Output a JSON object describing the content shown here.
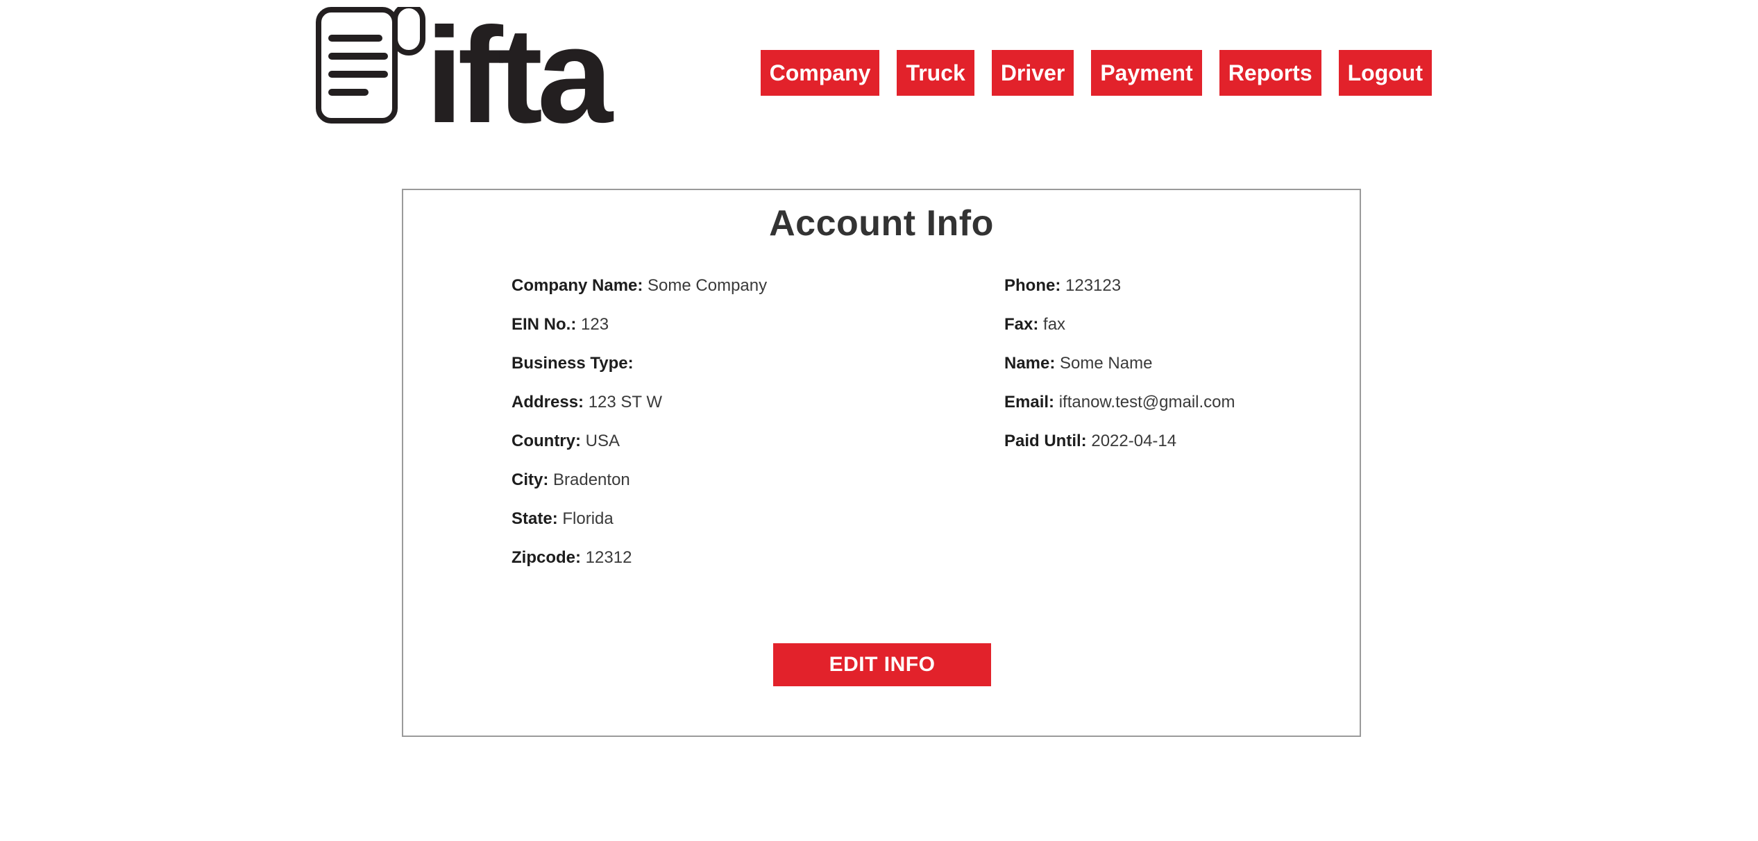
{
  "logo": {
    "text": "ifta",
    "icon": "document-icon"
  },
  "nav": [
    {
      "label": "Company"
    },
    {
      "label": "Truck"
    },
    {
      "label": "Driver"
    },
    {
      "label": "Payment"
    },
    {
      "label": "Reports"
    },
    {
      "label": "Logout"
    }
  ],
  "account": {
    "title": "Account Info",
    "left": [
      {
        "label": "Company Name:",
        "value": "Some Company"
      },
      {
        "label": "EIN No.:",
        "value": "123"
      },
      {
        "label": "Business Type:",
        "value": ""
      },
      {
        "label": "Address:",
        "value": "123 ST W"
      },
      {
        "label": "Country:",
        "value": "USA"
      },
      {
        "label": "City:",
        "value": "Bradenton"
      },
      {
        "label": "State:",
        "value": "Florida"
      },
      {
        "label": "Zipcode:",
        "value": "12312"
      }
    ],
    "right": [
      {
        "label": "Phone:",
        "value": "123123"
      },
      {
        "label": "Fax:",
        "value": "fax"
      },
      {
        "label": "Name:",
        "value": "Some Name"
      },
      {
        "label": "Email:",
        "value": "iftanow.test@gmail.com"
      },
      {
        "label": "Paid Until:",
        "value": "2022-04-14"
      }
    ],
    "edit_label": "EDIT INFO"
  },
  "colors": {
    "accent": "#e2222b",
    "text": "#333333",
    "border": "#9a9a9a"
  }
}
